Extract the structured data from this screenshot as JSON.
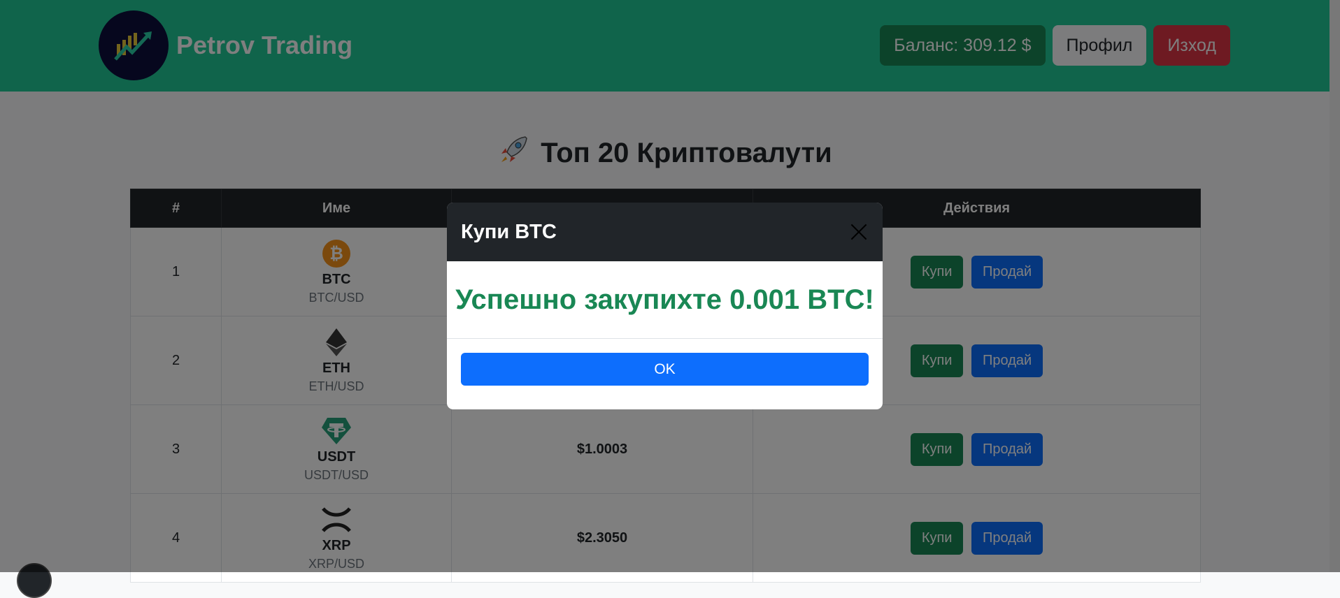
{
  "header": {
    "brand": "Petrov Trading",
    "balance_label": "Баланс: 309.12 $",
    "profile_label": "Профил",
    "logout_label": "Изход"
  },
  "main": {
    "title_icon": "rocket-icon",
    "title": "Топ 20 Криптовалути",
    "columns": [
      "#",
      "Име",
      "",
      "Действия"
    ],
    "rows": [
      {
        "rank": "1",
        "symbol": "BTC",
        "pair": "BTC/USD",
        "price": "",
        "icon": "bitcoin-icon"
      },
      {
        "rank": "2",
        "symbol": "ETH",
        "pair": "ETH/USD",
        "price": "",
        "icon": "ethereum-icon"
      },
      {
        "rank": "3",
        "symbol": "USDT",
        "pair": "USDT/USD",
        "price": "$1.0003",
        "icon": "tether-icon"
      },
      {
        "rank": "4",
        "symbol": "XRP",
        "pair": "XRP/USD",
        "price": "$2.3050",
        "icon": "xrp-icon"
      }
    ],
    "buy_label": "Купи",
    "sell_label": "Продай"
  },
  "modal": {
    "title": "Купи BTC",
    "message": "Успешно закупихте 0.001 BTC!",
    "ok_label": "OK"
  },
  "colors": {
    "navbar": "#20c997",
    "success": "#198754",
    "primary": "#0d6efd",
    "danger": "#dc3545",
    "dark": "#212529"
  }
}
